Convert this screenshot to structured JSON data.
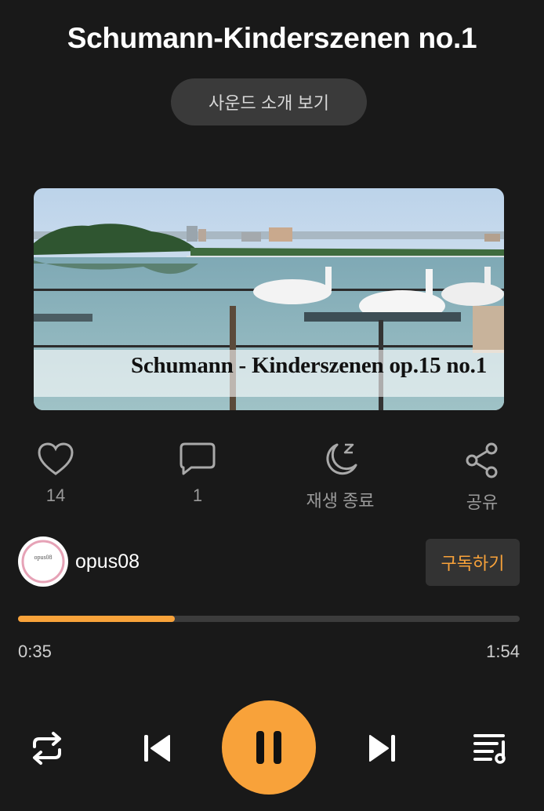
{
  "header": {
    "title": "Schumann-Kinderszenen no.1",
    "intro_button": "사운드 소개 보기"
  },
  "cover": {
    "caption": "Schumann - Kinderszenen op.15 no.1"
  },
  "actions": {
    "like": {
      "icon": "heart-icon",
      "label": "14"
    },
    "comment": {
      "icon": "comment-icon",
      "label": "1"
    },
    "sleep": {
      "icon": "moon-icon",
      "label": "재생 종료"
    },
    "share": {
      "icon": "share-icon",
      "label": "공유"
    }
  },
  "channel": {
    "name": "opus08",
    "avatar_text": "opus08",
    "subscribe": "구독하기"
  },
  "progress": {
    "current": "0:35",
    "total": "1:54",
    "fraction": 0.3125
  },
  "colors": {
    "accent": "#f8a23a",
    "background": "#191919"
  },
  "controls": [
    "repeat-icon",
    "previous-icon",
    "pause-icon",
    "next-icon",
    "playlist-icon"
  ]
}
